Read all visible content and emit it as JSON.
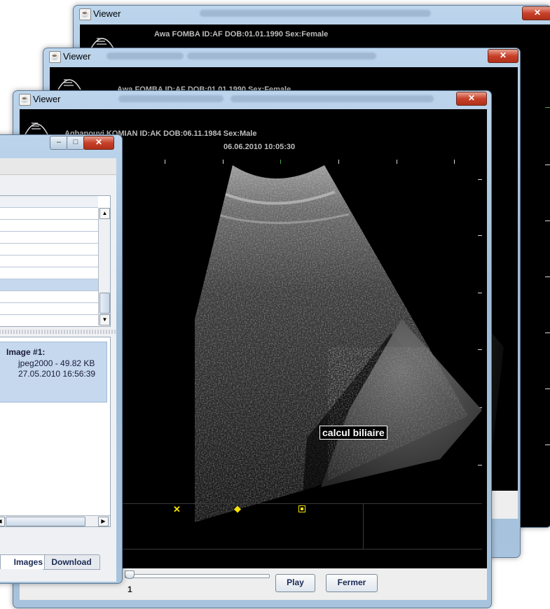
{
  "windows": {
    "back": {
      "title": "Viewer",
      "patient": "Awa FOMBA ID:AF DOB:01.01.1990 Sex:Female"
    },
    "middle": {
      "title": "Viewer",
      "patient": "Awa FOMBA ID:AF DOB:01.01.1990 Sex:Female"
    },
    "front": {
      "title": "Viewer",
      "patient": "Agbanouyi KOMIAN ID:AK DOB:06.11.1984 Sex:Male",
      "datetime": "06.06.2010 10:05:30",
      "annotation": "calcul biliaire",
      "slider_value": "1",
      "play_label": "Play",
      "close_label": "Fermer"
    }
  },
  "browser": {
    "image_title": "Image #1:",
    "image_format": "jpeg2000 - 49.82 KB",
    "image_date": "27.05.2010 16:56:39",
    "tabs": [
      "Images",
      "Download"
    ]
  },
  "icons": {
    "window": "java-icon",
    "probe": "ultrasound-probe-icon"
  },
  "colors": {
    "marker": "#f5e400",
    "close": "#c8402a",
    "selection": "#c5d8ee"
  }
}
